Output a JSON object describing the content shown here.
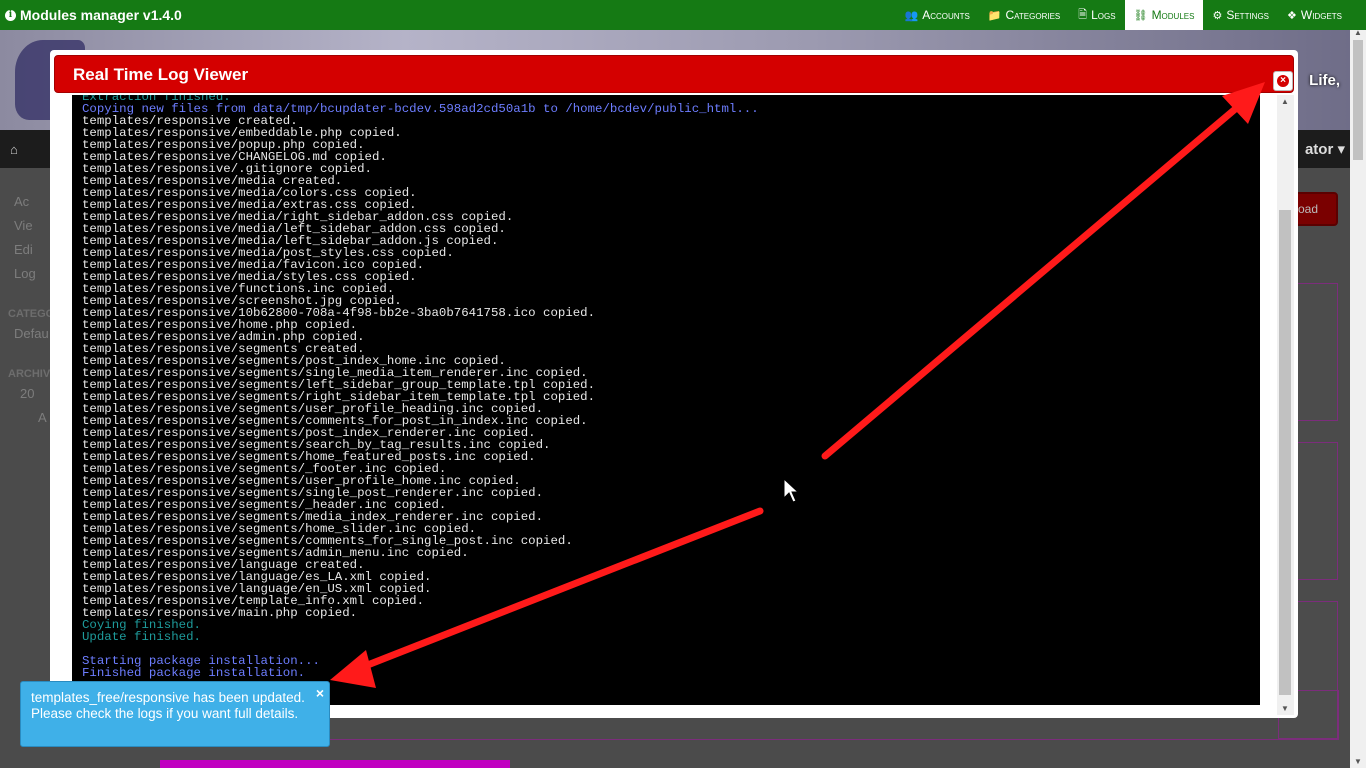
{
  "app": {
    "title": "Modules manager v1.4.0",
    "accent_color": "#157a14"
  },
  "topnav": [
    {
      "label": "Accounts",
      "icon": "users-icon",
      "glyph": "👥",
      "active": false
    },
    {
      "label": "Categories",
      "icon": "folder-icon",
      "glyph": "📁",
      "active": false
    },
    {
      "label": "Logs",
      "icon": "file-icon",
      "glyph": "🗎",
      "active": false
    },
    {
      "label": "Modules",
      "icon": "sitemap-icon",
      "glyph": "⛓",
      "active": true
    },
    {
      "label": "Settings",
      "icon": "cogs-icon",
      "glyph": "⚙",
      "active": false
    },
    {
      "label": "Widgets",
      "icon": "cubes-icon",
      "glyph": "❖",
      "active": false
    }
  ],
  "background": {
    "tagline": "Life,",
    "user_menu": "ator ▾",
    "upload_button": "oad",
    "sidebar": [
      "Ac",
      "Vie",
      "Edi",
      "Log"
    ],
    "categories_header": "CATEGO",
    "categories_item": "Defau",
    "archive_header": "ARCHIV",
    "archive_year": "20",
    "archive_month": "A"
  },
  "dialog": {
    "title": "Real Time Log Viewer",
    "title_color": "#d40000",
    "log": [
      {
        "cls": "teal",
        "text": "Extraction finished."
      },
      {
        "cls": "blue",
        "text": "Copying new files from data/tmp/bcupdater-bcdev.598ad2cd50a1b to /home/bcdev/public_html..."
      },
      {
        "cls": "white",
        "text": "templates/responsive created."
      },
      {
        "cls": "white",
        "text": "templates/responsive/embeddable.php copied."
      },
      {
        "cls": "white",
        "text": "templates/responsive/popup.php copied."
      },
      {
        "cls": "white",
        "text": "templates/responsive/CHANGELOG.md copied."
      },
      {
        "cls": "white",
        "text": "templates/responsive/.gitignore copied."
      },
      {
        "cls": "white",
        "text": "templates/responsive/media created."
      },
      {
        "cls": "white",
        "text": "templates/responsive/media/colors.css copied."
      },
      {
        "cls": "white",
        "text": "templates/responsive/media/extras.css copied."
      },
      {
        "cls": "white",
        "text": "templates/responsive/media/right_sidebar_addon.css copied."
      },
      {
        "cls": "white",
        "text": "templates/responsive/media/left_sidebar_addon.css copied."
      },
      {
        "cls": "white",
        "text": "templates/responsive/media/left_sidebar_addon.js copied."
      },
      {
        "cls": "white",
        "text": "templates/responsive/media/post_styles.css copied."
      },
      {
        "cls": "white",
        "text": "templates/responsive/media/favicon.ico copied."
      },
      {
        "cls": "white",
        "text": "templates/responsive/media/styles.css copied."
      },
      {
        "cls": "white",
        "text": "templates/responsive/functions.inc copied."
      },
      {
        "cls": "white",
        "text": "templates/responsive/screenshot.jpg copied."
      },
      {
        "cls": "white",
        "text": "templates/responsive/10b62800-708a-4f98-bb2e-3ba0b7641758.ico copied."
      },
      {
        "cls": "white",
        "text": "templates/responsive/home.php copied."
      },
      {
        "cls": "white",
        "text": "templates/responsive/admin.php copied."
      },
      {
        "cls": "white",
        "text": "templates/responsive/segments created."
      },
      {
        "cls": "white",
        "text": "templates/responsive/segments/post_index_home.inc copied."
      },
      {
        "cls": "white",
        "text": "templates/responsive/segments/single_media_item_renderer.inc copied."
      },
      {
        "cls": "white",
        "text": "templates/responsive/segments/left_sidebar_group_template.tpl copied."
      },
      {
        "cls": "white",
        "text": "templates/responsive/segments/right_sidebar_item_template.tpl copied."
      },
      {
        "cls": "white",
        "text": "templates/responsive/segments/user_profile_heading.inc copied."
      },
      {
        "cls": "white",
        "text": "templates/responsive/segments/comments_for_post_in_index.inc copied."
      },
      {
        "cls": "white",
        "text": "templates/responsive/segments/post_index_renderer.inc copied."
      },
      {
        "cls": "white",
        "text": "templates/responsive/segments/search_by_tag_results.inc copied."
      },
      {
        "cls": "white",
        "text": "templates/responsive/segments/home_featured_posts.inc copied."
      },
      {
        "cls": "white",
        "text": "templates/responsive/segments/_footer.inc copied."
      },
      {
        "cls": "white",
        "text": "templates/responsive/segments/user_profile_home.inc copied."
      },
      {
        "cls": "white",
        "text": "templates/responsive/segments/single_post_renderer.inc copied."
      },
      {
        "cls": "white",
        "text": "templates/responsive/segments/_header.inc copied."
      },
      {
        "cls": "white",
        "text": "templates/responsive/segments/media_index_renderer.inc copied."
      },
      {
        "cls": "white",
        "text": "templates/responsive/segments/home_slider.inc copied."
      },
      {
        "cls": "white",
        "text": "templates/responsive/segments/comments_for_single_post.inc copied."
      },
      {
        "cls": "white",
        "text": "templates/responsive/segments/admin_menu.inc copied."
      },
      {
        "cls": "white",
        "text": "templates/responsive/language created."
      },
      {
        "cls": "white",
        "text": "templates/responsive/language/es_LA.xml copied."
      },
      {
        "cls": "white",
        "text": "templates/responsive/language/en_US.xml copied."
      },
      {
        "cls": "white",
        "text": "templates/responsive/template_info.xml copied."
      },
      {
        "cls": "white",
        "text": "templates/responsive/main.php copied."
      },
      {
        "cls": "teal",
        "text": "Coying finished."
      },
      {
        "cls": "teal",
        "text": "Update finished."
      },
      {
        "cls": "blank",
        "text": ""
      },
      {
        "cls": "blue",
        "text": "Starting package installation..."
      },
      {
        "cls": "blue",
        "text": "Finished package installation."
      }
    ]
  },
  "toast": {
    "message": "templates_free/responsive has been updated. Please check the logs if you want full details.",
    "close_glyph": "×",
    "color": "#3fb0e8"
  }
}
